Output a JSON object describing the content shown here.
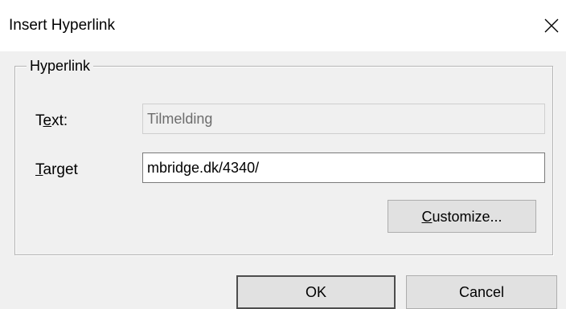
{
  "window": {
    "title": "Insert Hyperlink",
    "close_icon": "close-icon"
  },
  "group": {
    "legend": "Hyperlink"
  },
  "fields": {
    "text_label_pre": "T",
    "text_label_mnemonic": "e",
    "text_label_post": "xt:",
    "text_value": "Tilmelding",
    "target_label_mnemonic": "T",
    "target_label_post": "arget",
    "target_value": "mbridge.dk/4340/"
  },
  "buttons": {
    "customize_mnemonic": "C",
    "customize_post": "ustomize...",
    "ok_label": "OK",
    "cancel_label": "Cancel"
  }
}
